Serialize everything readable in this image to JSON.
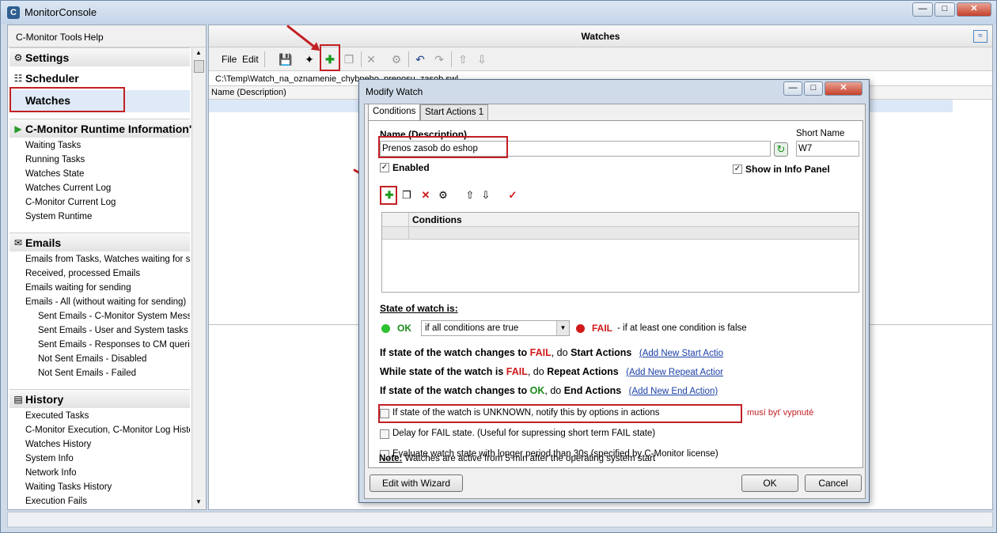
{
  "window": {
    "title": "MonitorConsole"
  },
  "menu": {
    "tools": "C-Monitor Tools",
    "help": "Help"
  },
  "nav": {
    "settings": "Settings",
    "scheduler": "Scheduler",
    "watches": "Watches",
    "runtime": "C-Monitor Runtime Information'",
    "runtime_items": [
      "Waiting Tasks",
      "Running Tasks",
      "Watches State",
      "Watches Current Log",
      "C-Monitor Current Log",
      "System Runtime"
    ],
    "emails": "Emails",
    "email_items": [
      "Emails from Tasks, Watches waiting for send",
      "Received, processed Emails",
      "Emails waiting for sending",
      "Emails - All (without waiting for sending)"
    ],
    "email_sub_items": [
      "Sent Emails - C-Monitor System Message",
      "Sent Emails - User and System tasks Res",
      "Sent Emails - Responses to CM queries",
      "Not Sent Emails - Disabled",
      "Not Sent Emails - Failed"
    ],
    "history": "History",
    "history_items": [
      "Executed Tasks",
      "C-Monitor Execution, C-Monitor Log History",
      "Watches History",
      "System Info",
      "Network Info",
      "Waiting Tasks History",
      "Execution Fails"
    ]
  },
  "right": {
    "title": "Watches",
    "file_menu": "File",
    "edit_menu": "Edit",
    "path": "C:\\Temp\\Watch_na_oznamenie_chybneho_prenosu_zasob.swl",
    "column_header": "Name (Description)"
  },
  "dialog": {
    "title": "Modify Watch",
    "tabs": [
      "Conditions",
      "Start Actions 1"
    ],
    "name_label": "Name (Description)",
    "name_value": "Prenos zasob do eshop",
    "short_name_label": "Short Name",
    "short_name_value": "W7",
    "enabled_label": "Enabled",
    "show_info_label": "Show in Info Panel",
    "conditions_header": "Conditions",
    "state_label": "State of watch is:",
    "ok_label": "OK",
    "condition_select": "if all conditions are true",
    "fail_label": "FAIL",
    "fail_desc": "- if at least one condition is false",
    "line1_a": "If state of the watch changes to",
    "line1_fail": "FAIL",
    "line1_b": ", do",
    "line1_c": "Start Actions",
    "line1_link": "(Add New Start Actio",
    "line2_a": "While state of the watch is",
    "line2_fail": "FAIL",
    "line2_b": ", do",
    "line2_c": "Repeat Actions",
    "line2_link": "(Add New Repeat Actior",
    "line3_a": "If state of the watch changes to",
    "line3_ok": "OK",
    "line3_b": ", do",
    "line3_c": "End Actions",
    "line3_link": "(Add New End Action)",
    "unknown_label": "If state of the watch is UNKNOWN, notify this by options in actions",
    "annotation": "musí byť vypnuté",
    "delay_label": "Delay for FAIL state. (Useful for supressing short term FAIL state)",
    "evaluate_label": "Evaluate watch state with longer period than 30s (specified by C-Monitor license)",
    "note_bold": "Note:",
    "note_text": "Watches are active from 5 min after the operating system start",
    "wizard_btn": "Edit with Wizard",
    "ok_btn": "OK",
    "cancel_btn": "Cancel"
  },
  "colors": {
    "highlight": "#c21f24",
    "fail": "#d01a1a",
    "ok": "#1a8a1a",
    "link": "#1a3fa6"
  }
}
